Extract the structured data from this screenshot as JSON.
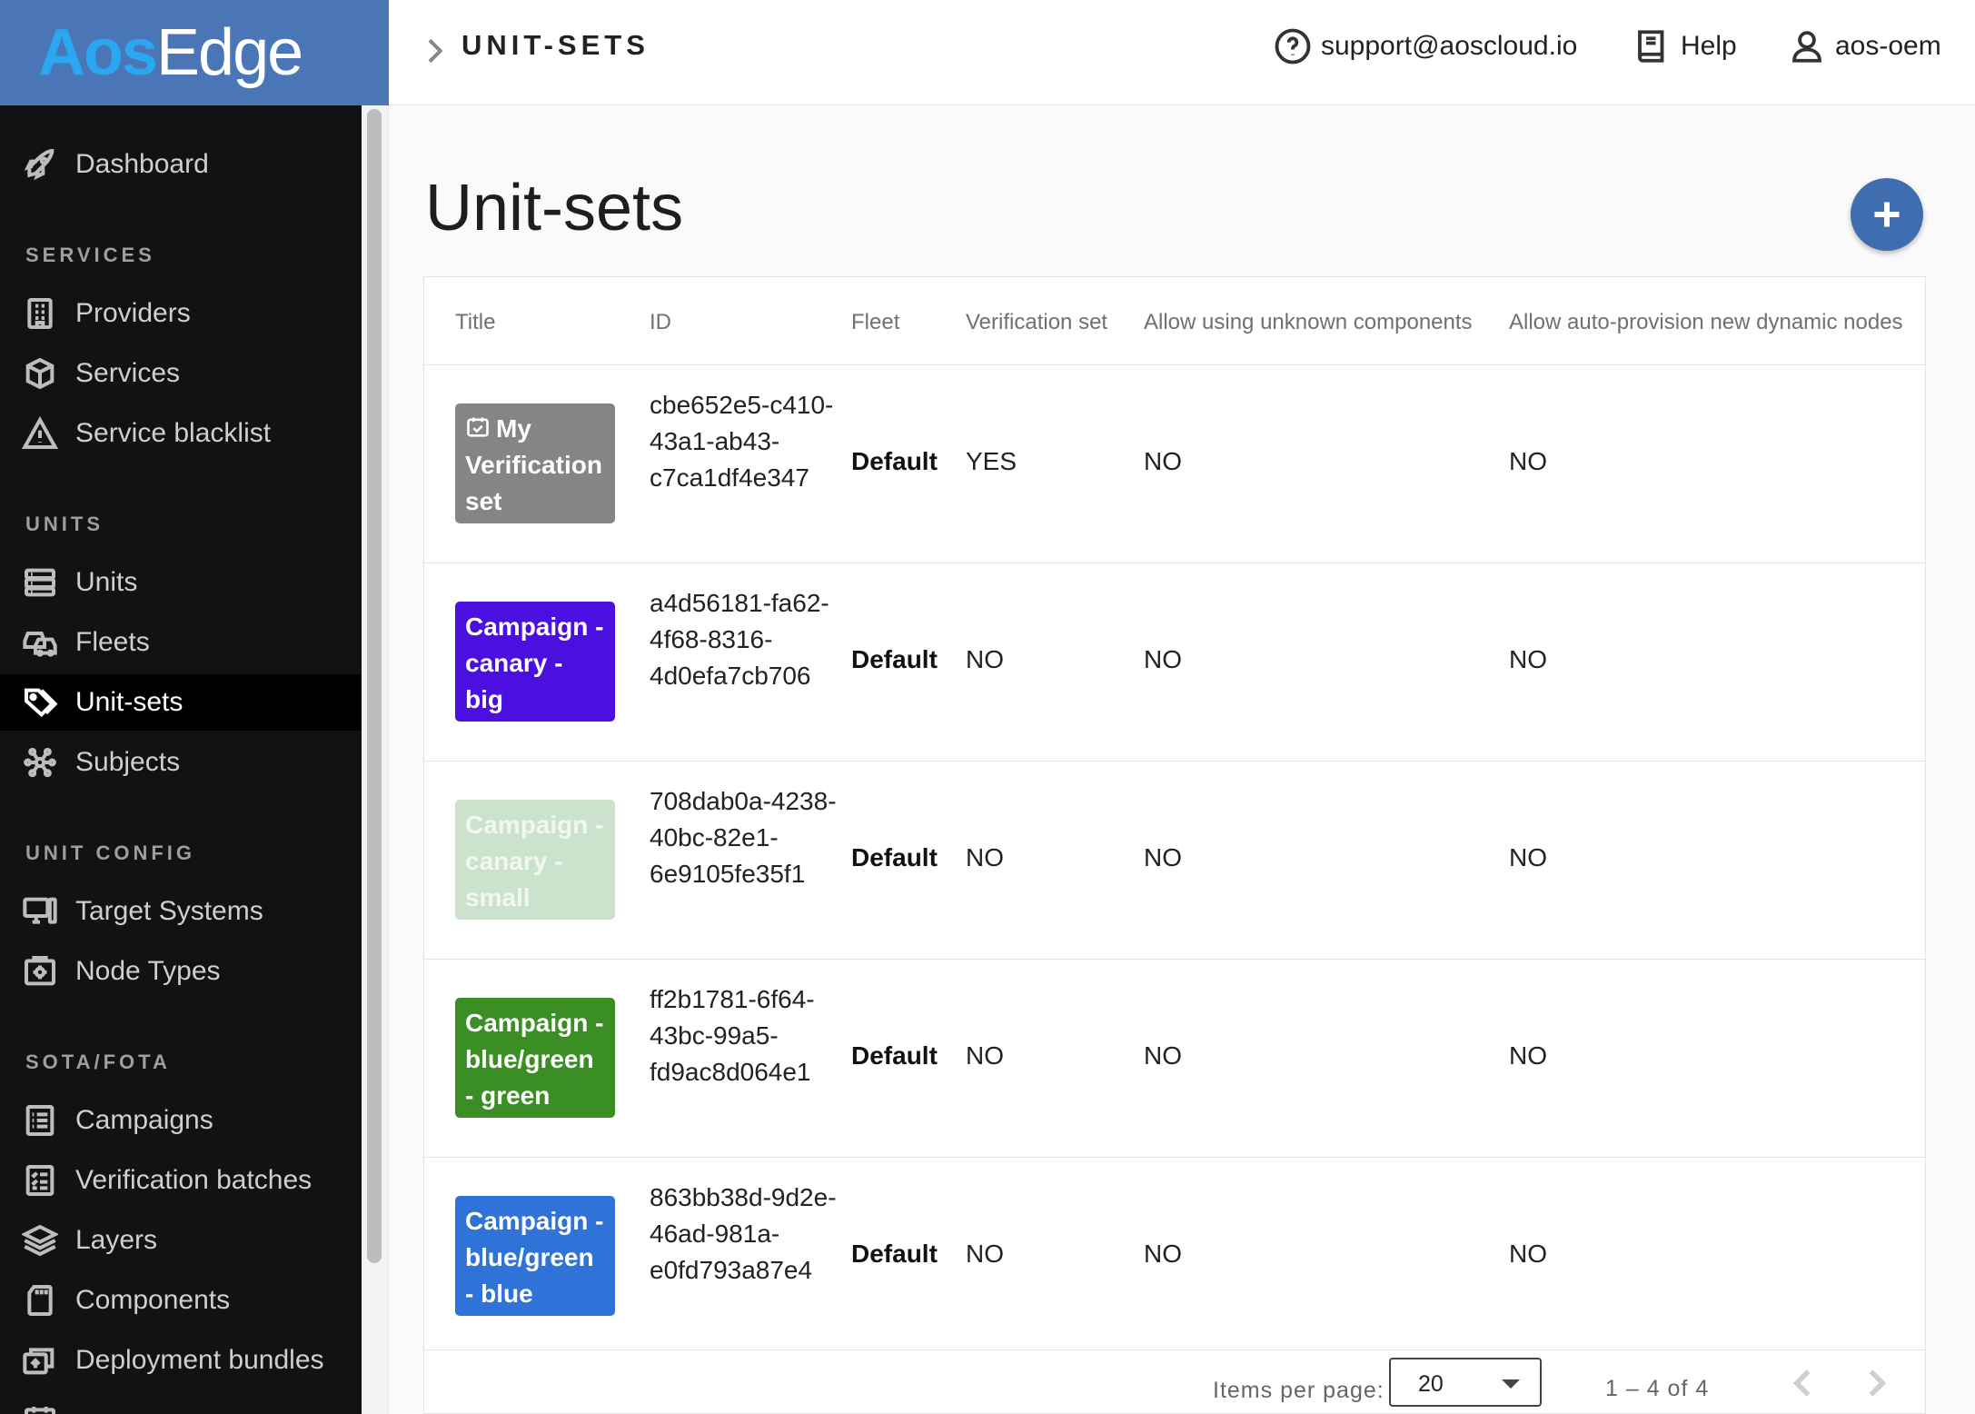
{
  "brand": {
    "aos": "Aos",
    "edge": "Edge"
  },
  "header": {
    "breadcrumb": "UNIT-SETS",
    "support": "support@aoscloud.io",
    "help": "Help",
    "user": "aos-oem"
  },
  "sidebar": {
    "dashboard": "Dashboard",
    "sections": {
      "services": "SERVICES",
      "units": "UNITS",
      "unit_config": "UNIT CONFIG",
      "sota_fota": "SOTA/FOTA"
    },
    "items": {
      "providers": "Providers",
      "services": "Services",
      "service_blacklist": "Service blacklist",
      "units": "Units",
      "fleets": "Fleets",
      "unit_sets": "Unit-sets",
      "subjects": "Subjects",
      "target_systems": "Target Systems",
      "node_types": "Node Types",
      "campaigns": "Campaigns",
      "verification_batches": "Verification batches",
      "layers": "Layers",
      "components": "Components",
      "deployment_bundles": "Deployment bundles"
    }
  },
  "main": {
    "title": "Unit-sets",
    "columns": {
      "title": "Title",
      "id": "ID",
      "fleet": "Fleet",
      "verification_set": "Verification set",
      "allow_unknown": "Allow using unknown components",
      "allow_autoprovision": "Allow auto-provision new dynamic nodes"
    },
    "rows": [
      {
        "title": "My Verification set",
        "id": "cbe652e5-c410-43a1-ab43-c7ca1df4e347",
        "fleet": "Default",
        "verification_set": "YES",
        "allow_unknown": "NO",
        "allow_autoprovision": "NO",
        "color": "#858585",
        "text_color": "#ffffff"
      },
      {
        "title": "Campaign - canary - big",
        "id": "a4d56181-fa62-4f68-8316-4d0efa7cb706",
        "fleet": "Default",
        "verification_set": "NO",
        "allow_unknown": "NO",
        "allow_autoprovision": "NO",
        "color": "#4b0fe0",
        "text_color": "#ffffff"
      },
      {
        "title": "Campaign - canary - small",
        "id": "708dab0a-4238-40bc-82e1-6e9105fe35f1",
        "fleet": "Default",
        "verification_set": "NO",
        "allow_unknown": "NO",
        "allow_autoprovision": "NO",
        "color": "#cbe3cc",
        "text_color": "#f2f7f2"
      },
      {
        "title": "Campaign - blue/green - green",
        "id": "ff2b1781-6f64-43bc-99a5-fd9ac8d064e1",
        "fleet": "Default",
        "verification_set": "NO",
        "allow_unknown": "NO",
        "allow_autoprovision": "NO",
        "color": "#3a8e23",
        "text_color": "#ffffff"
      },
      {
        "title": "Campaign - blue/green - blue",
        "id": "863bb38d-9d2e-46ad-981a-e0fd793a87e4",
        "fleet": "Default",
        "verification_set": "NO",
        "allow_unknown": "NO",
        "allow_autoprovision": "NO",
        "color": "#2f72d8",
        "text_color": "#ffffff"
      }
    ],
    "paginator": {
      "items_per_page_label": "Items per page:",
      "items_per_page": "20",
      "range": "1 – 4 of 4"
    }
  }
}
